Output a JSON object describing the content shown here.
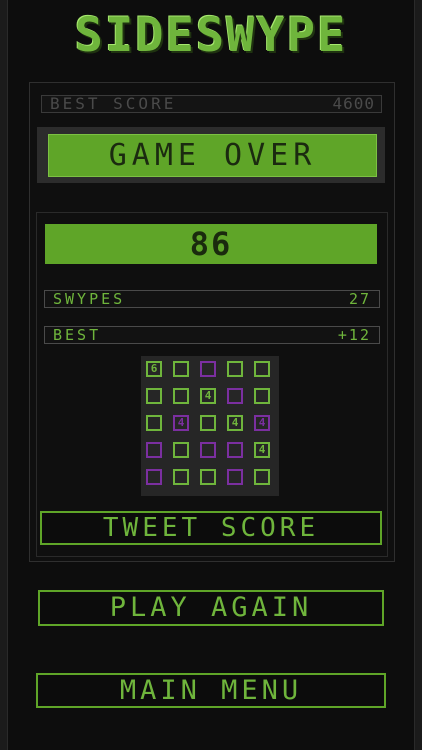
{
  "title": "SIDESWYPE",
  "best_score": {
    "label": "BEST SCORE",
    "value": "4600"
  },
  "status": "GAME OVER",
  "score": "86",
  "stats": [
    {
      "label": "SWYPES",
      "value": "27"
    },
    {
      "label": "BEST",
      "value": "+12"
    }
  ],
  "board": {
    "rows": [
      [
        {
          "t": "6",
          "c": "g"
        },
        {
          "t": "",
          "c": "g"
        },
        {
          "t": "",
          "c": "p"
        },
        {
          "t": "",
          "c": "g"
        },
        {
          "t": "",
          "c": "g"
        }
      ],
      [
        {
          "t": "",
          "c": "g"
        },
        {
          "t": "",
          "c": "g"
        },
        {
          "t": "4",
          "c": "g"
        },
        {
          "t": "",
          "c": "p"
        },
        {
          "t": "",
          "c": "g"
        }
      ],
      [
        {
          "t": "",
          "c": "g"
        },
        {
          "t": "4",
          "c": "p"
        },
        {
          "t": "",
          "c": "g"
        },
        {
          "t": "4",
          "c": "g"
        },
        {
          "t": "4",
          "c": "p"
        }
      ],
      [
        {
          "t": "",
          "c": "p"
        },
        {
          "t": "",
          "c": "g"
        },
        {
          "t": "",
          "c": "p"
        },
        {
          "t": "",
          "c": "p"
        },
        {
          "t": "4",
          "c": "g"
        }
      ],
      [
        {
          "t": "",
          "c": "p"
        },
        {
          "t": "",
          "c": "g"
        },
        {
          "t": "",
          "c": "g"
        },
        {
          "t": "",
          "c": "p"
        },
        {
          "t": "",
          "c": "g"
        }
      ]
    ]
  },
  "buttons": {
    "tweet": "TWEET SCORE",
    "play_again": "PLAY AGAIN",
    "main_menu": "MAIN MENU"
  },
  "colors": {
    "accent": "#5fa528",
    "purple": "#7b2fa0",
    "background": "#0d0d0d"
  }
}
